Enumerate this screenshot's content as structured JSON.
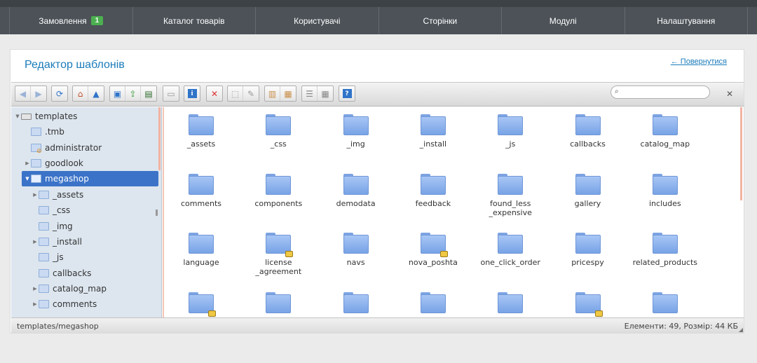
{
  "nav": {
    "items": [
      {
        "label": "Замовлення",
        "badge": "1"
      },
      {
        "label": "Каталог товарів"
      },
      {
        "label": "Користувачі"
      },
      {
        "label": "Сторінки"
      },
      {
        "label": "Модулі"
      },
      {
        "label": "Налаштування"
      }
    ]
  },
  "page": {
    "title": "Редактор шаблонів",
    "back_link": "← Повернутися"
  },
  "toolbar": {
    "search_placeholder": ""
  },
  "tree": {
    "items": [
      {
        "label": "templates",
        "icon": "drive-icon"
      },
      {
        "label": ".tmb"
      },
      {
        "label": "administrator",
        "locked": true
      },
      {
        "label": "goodlook"
      },
      {
        "label": "megashop",
        "selected": true
      },
      {
        "label": "_assets"
      },
      {
        "label": "_css"
      },
      {
        "label": "_img"
      },
      {
        "label": "_install"
      },
      {
        "label": "_js"
      },
      {
        "label": "callbacks"
      },
      {
        "label": "catalog_map"
      },
      {
        "label": "comments"
      }
    ]
  },
  "files": {
    "items": [
      {
        "name": "_assets"
      },
      {
        "name": "_css"
      },
      {
        "name": "_img"
      },
      {
        "name": "_install"
      },
      {
        "name": "_js"
      },
      {
        "name": "callbacks"
      },
      {
        "name": "catalog_map"
      },
      {
        "name": "comments"
      },
      {
        "name": "components"
      },
      {
        "name": "demodata"
      },
      {
        "name": "feedback"
      },
      {
        "name": "found_less\n_expensive"
      },
      {
        "name": "gallery"
      },
      {
        "name": "includes"
      },
      {
        "name": "language"
      },
      {
        "name": "license\n_agreement",
        "locked": true
      },
      {
        "name": "navs"
      },
      {
        "name": "nova_poshta",
        "locked": true
      },
      {
        "name": "one_click_order"
      },
      {
        "name": "pricespy"
      },
      {
        "name": "related_products"
      },
      {
        "name": "",
        "locked": true
      },
      {
        "name": ""
      },
      {
        "name": ""
      },
      {
        "name": ""
      },
      {
        "name": ""
      },
      {
        "name": "",
        "locked": true
      },
      {
        "name": ""
      }
    ]
  },
  "status": {
    "path": "templates/megashop",
    "info": "Елементи: 49, Розмір: 44 КБ"
  }
}
